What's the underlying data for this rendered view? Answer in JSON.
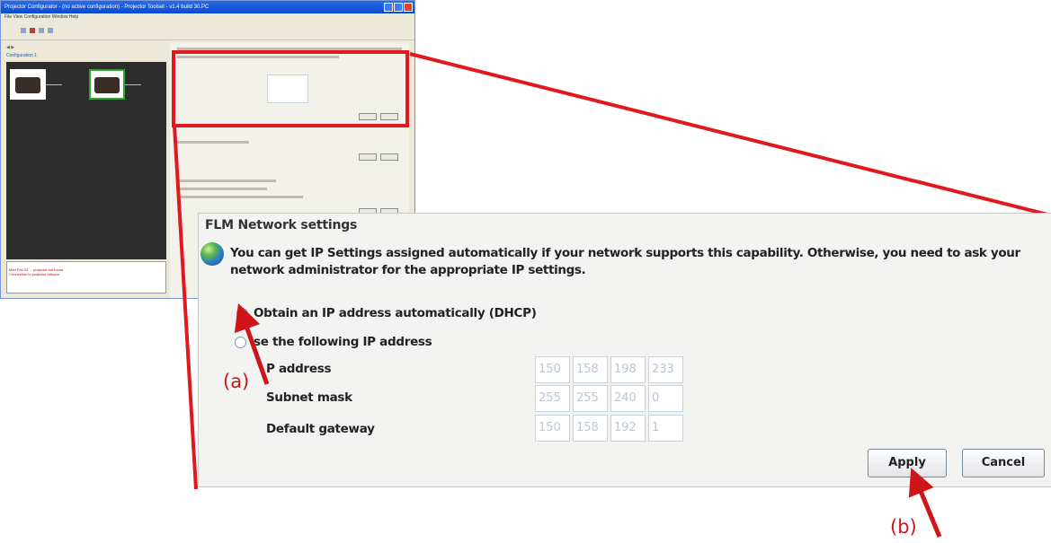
{
  "mini": {
    "title": "Projector Configurator - (no active configuration) - Projector Toolset - v1.4 build 30.PC",
    "menu": "File  View  Configuration  Window  Help",
    "nav": "◀ ▶",
    "configuration_label": "Configuration 1",
    "log_lines": [
      "Mon Feb 23 ... projector not found",
      "Connection to projector refused"
    ]
  },
  "panel": {
    "title": "FLM Network settings",
    "info": "You can get IP Settings assigned automatically if your network supports this capability. Otherwise, you need to ask your network administrator for the appropriate IP settings.",
    "radio_dhcp": "Obtain an IP address automatically (DHCP)",
    "radio_static": "se the following IP address",
    "ip_label": "P address",
    "subnet_label": "Subnet mask",
    "gateway_label": "Default gateway",
    "ip": [
      "150",
      "158",
      "198",
      "233"
    ],
    "subnet": [
      "255",
      "255",
      "240",
      "0"
    ],
    "gateway": [
      "150",
      "158",
      "192",
      "1"
    ],
    "apply": "Apply",
    "cancel": "Cancel"
  },
  "annotations": {
    "a": "(a)",
    "b": "(b)"
  },
  "colors": {
    "annotation_red": "#d0151a",
    "panel_bg": "#f3f3f1"
  }
}
